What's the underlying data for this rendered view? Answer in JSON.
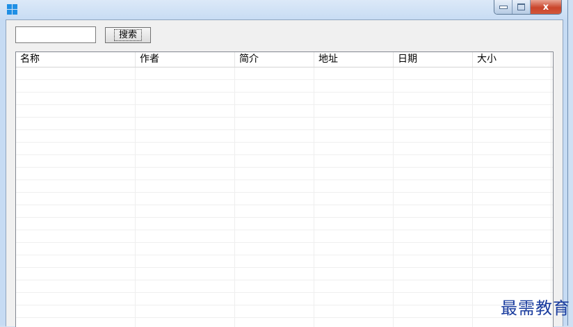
{
  "search": {
    "value": "",
    "placeholder": "",
    "button_label": "搜索"
  },
  "table": {
    "columns": [
      "名称",
      "作者",
      "简介",
      "地址",
      "日期",
      "大小"
    ],
    "rows": []
  },
  "title_bar": {
    "icon": "windows-logo-icon",
    "buttons": [
      "minimize-icon",
      "maximize-icon",
      "close-icon"
    ],
    "close_glyph": "x"
  },
  "watermark": "最需教育"
}
